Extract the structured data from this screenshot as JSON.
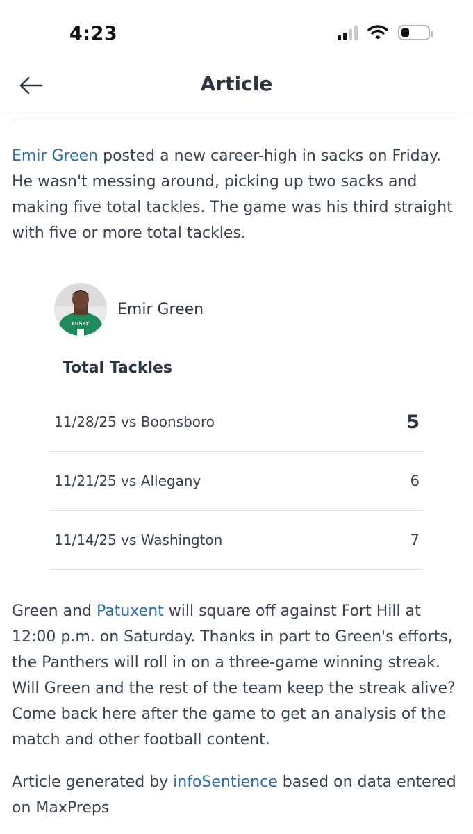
{
  "status": {
    "time": "4:23"
  },
  "header": {
    "title": "Article"
  },
  "article": {
    "para1": {
      "player_link": "Emir Green",
      "text": " posted a new career-high in sacks on Friday. He wasn't messing around, picking up two sacks and making five total tackles. The game was his third straight with five or more total tackles."
    },
    "player": {
      "name": "Emir Green",
      "jersey_text": "LUSBY"
    },
    "stat": {
      "title": "Total Tackles",
      "rows": [
        {
          "label": "11/28/25 vs Boonsboro",
          "value": "5"
        },
        {
          "label": "11/21/25 vs Allegany",
          "value": "6"
        },
        {
          "label": "11/14/25 vs Washington",
          "value": "7"
        }
      ]
    },
    "para2": {
      "lead": "Green and ",
      "team_link": "Patuxent",
      "text": " will square off against Fort Hill at 12:00 p.m. on Saturday. Thanks in part to Green's efforts, the Panthers will roll in on a three-game winning streak. Will Green and the rest of the team keep the streak alive? Come back here after the game to get an analysis of the match and other football content."
    },
    "para3": {
      "lead": "Article generated by ",
      "source_link": "infoSentience",
      "text": " based on data entered on MaxPreps"
    }
  },
  "colors": {
    "link": "#2a6db3",
    "jersey": "#1f8a5b",
    "text": "#2b3440"
  },
  "icons": {
    "back": "arrow-left-icon",
    "signal": "cellular-signal-icon",
    "wifi": "wifi-icon",
    "battery": "battery-icon"
  }
}
